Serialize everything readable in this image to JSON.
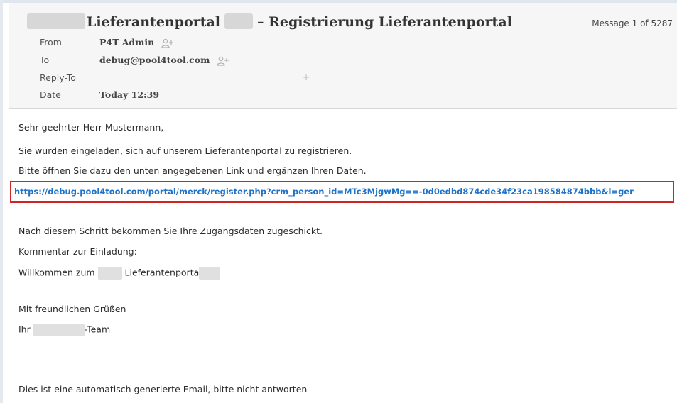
{
  "email": {
    "subject_part1": "Lieferantenportal",
    "subject_sep": "– Registrierung Lieferantenportal",
    "message_counter": "Message 1 of 5287",
    "meta": [
      {
        "label": "From",
        "value": "P4T Admin"
      },
      {
        "label": "To",
        "value": "debug@pool4tool.com"
      },
      {
        "label": "Reply-To",
        "value": ""
      },
      {
        "label": "Date",
        "value": "Today 12:39"
      }
    ]
  },
  "body": {
    "greeting": "Sehr geehrter Herr Mustermann,",
    "line1": "Sie wurden eingeladen, sich auf unserem Lieferantenportal zu registrieren.",
    "line2": "Bitte öffnen Sie dazu den unten angegebenen Link und ergänzen Ihren Daten.",
    "link": "https://debug.pool4tool.com/portal/merck/register.php?crm_person_id=MTc3MjgwMg==-0d0edbd874cde34f23ca198584874bbb&l=ger",
    "line3": "Nach diesem Schritt bekommen Sie Ihre Zugangsdaten zugeschickt.",
    "comment_label": "Kommentar zur Einladung:",
    "welcome_pre": "Willkommen zum",
    "welcome_mid": "Lieferantenporta",
    "closing": "Mit freundlichen Grüßen",
    "sign_pre": "Ihr",
    "sign_post": "-Team",
    "footer": "Dies ist eine automatisch generierte Email, bitte nicht antworten"
  },
  "colors": {
    "link": "#1e73c8",
    "highlight_border": "#d02525",
    "header_bg": "#f6f6f6"
  },
  "icons": {
    "add_contact": "person-plus-icon"
  }
}
